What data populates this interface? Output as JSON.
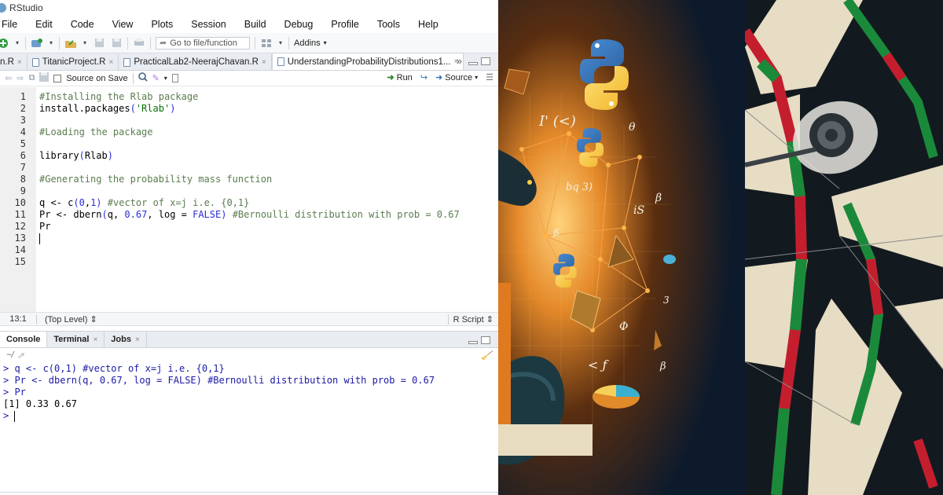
{
  "window": {
    "title": "RStudio"
  },
  "menu": [
    "File",
    "Edit",
    "Code",
    "View",
    "Plots",
    "Session",
    "Build",
    "Debug",
    "Profile",
    "Tools",
    "Help"
  ],
  "toolbar": {
    "goto_placeholder": "Go to file/function",
    "addins_label": "Addins"
  },
  "tabs": [
    {
      "label": "n.R",
      "active": false
    },
    {
      "label": "TitanicProject.R",
      "active": false
    },
    {
      "label": "PracticalLab2-NeerajChavan.R",
      "active": false
    },
    {
      "label": "UnderstandingProbabilityDistributions1...",
      "active": true
    }
  ],
  "editor_toolbar": {
    "source_on_save": "Source on Save",
    "run": "Run",
    "source": "Source"
  },
  "code_lines": [
    "#Installing the Rlab package",
    "install.packages('Rlab')",
    "",
    "#Loading the package",
    "",
    "library(Rlab)",
    "",
    "#Generating the probability mass function",
    "",
    "q <- c(0,1) #vector of x=j i.e. {0,1}",
    "Pr <- dbern(q, 0.67, log = FALSE) #Bernoulli distribution with prob = 0.67",
    "Pr",
    "",
    "",
    ""
  ],
  "line_numbers": [
    "1",
    "2",
    "3",
    "4",
    "5",
    "6",
    "7",
    "8",
    "9",
    "10",
    "11",
    "12",
    "13",
    "14",
    "15"
  ],
  "statusbar": {
    "position": "13:1",
    "scope": "(Top Level)",
    "filetype": "R Script"
  },
  "console_tabs": [
    "Console",
    "Terminal",
    "Jobs"
  ],
  "console": {
    "path": "~/",
    "lines": [
      {
        "text": "> q <- c(0,1) #vector of x=j i.e. {0,1}",
        "kind": "input"
      },
      {
        "text": "> Pr <- dbern(q, 0.67, log = FALSE) #Bernoulli distribution with prob = 0.67",
        "kind": "input"
      },
      {
        "text": "> Pr",
        "kind": "input"
      },
      {
        "text": "[1] 0.33 0.67",
        "kind": "output"
      },
      {
        "text": "> ",
        "kind": "input"
      }
    ]
  },
  "art_text": [
    "I' (<)",
    "bq 3)",
    "iS",
    "β",
    "3",
    "ß",
    "θ",
    "Φ",
    "< ƒ",
    "β"
  ],
  "colors": {
    "editor_bg": "#ffffff",
    "gutter_bg": "#f0f0f0",
    "comment": "#5a7c4e",
    "string": "#037103",
    "number": "#2b2bdb",
    "console_input": "#1a1aa6",
    "art_bg": "#0c1a2c",
    "art_glow": "#f2a33a",
    "dart_red": "#c41e2e",
    "dart_green": "#1a8a3a",
    "dart_cream": "#e7dcc4",
    "dart_black": "#121a1f"
  }
}
